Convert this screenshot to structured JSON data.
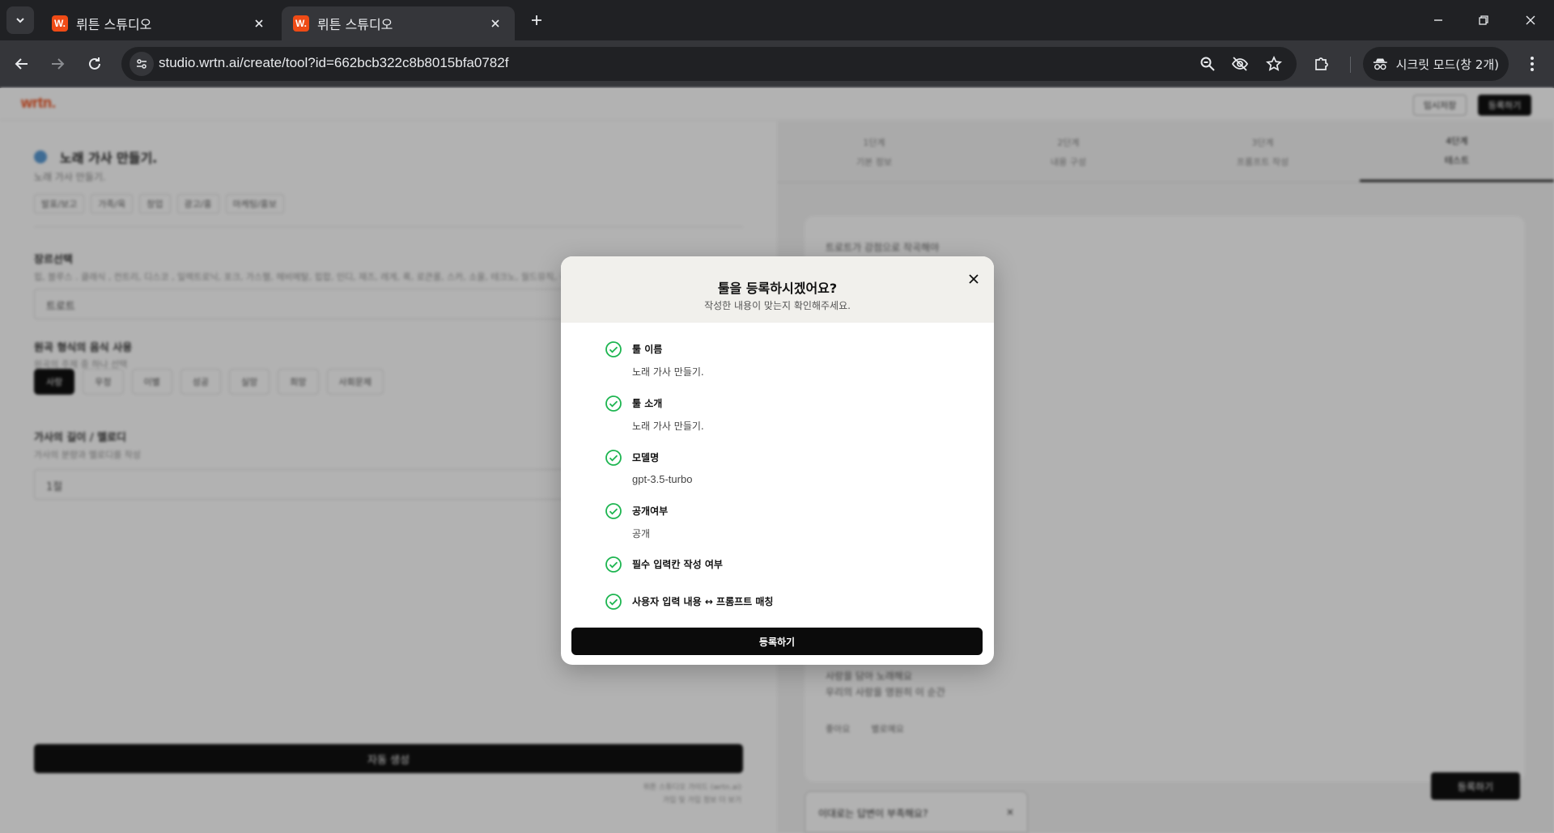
{
  "browser": {
    "tabs": [
      {
        "title": "뤼튼 스튜디오",
        "favicon": "W."
      },
      {
        "title": "뤼튼 스튜디오",
        "favicon": "W."
      }
    ],
    "url": "studio.wrtn.ai/create/tool?id=662bcb322c8b8015bfa0782f",
    "incognito_label": "시크릿 모드(창 2개)"
  },
  "page": {
    "logo": "wrtn.",
    "header_buttons": [
      "임시저장",
      "등록하기"
    ],
    "tool_title": "노래 가사 만들기.",
    "tool_subtitle": "노래 가사 만들기.",
    "tags": [
      "발표/보고",
      "가족/육",
      "창업",
      "광고/홍",
      "마케팅/홍보"
    ],
    "fields": [
      {
        "label": "장르선택",
        "hint": "힙, 블루스 . 클래식 , 컨트리, 디스코 , 일렉트로닉, 포크, 가스펠, 헤비메탈, 힙합, 인디, 재즈, 레게, 록, 로큰롤, 스카, 소울, 테크노, 월드뮤직, 국악, 트로트",
        "value": "트로트"
      },
      {
        "label": "원곡 형식의 음식 사용",
        "hint": "원곡의 주제 중 하나 선택",
        "value": ""
      },
      {
        "label": "가사의 길이 / 멜로디",
        "hint": "가사의 분량과 멜로디를 작성",
        "value": "1절"
      }
    ],
    "chips": [
      "사랑",
      "우정",
      "이별",
      "성공",
      "실망",
      "희망",
      "사회문제"
    ],
    "generate_button": "자동 생성",
    "footnotes": [
      "뤼튼 스튜디오 가이드 (wrtn.ai)",
      "가입 및 가입 정보 더 보기"
    ],
    "steps": [
      {
        "num": "1단계",
        "label": "기본 정보"
      },
      {
        "num": "2단계",
        "label": "내용 구성"
      },
      {
        "num": "3단계",
        "label": "프롬프트 작성"
      },
      {
        "num": "4단계",
        "label": "테스트"
      }
    ],
    "result_lines": [
      "트로트가 강점으로 작곡해야",
      "사랑을 담아 노래해요",
      "우리의 사랑을 영원히 이 순간"
    ],
    "card_actions": [
      "좋아요",
      "별로예요"
    ],
    "submit_button": "등록하기",
    "feedback_prompt": "이대로는 답변이 부족해요?"
  },
  "modal": {
    "title": "툴을 등록하시겠어요?",
    "subtitle": "작성한 내용이 맞는지 확인해주세요.",
    "items": [
      {
        "label": "툴 이름",
        "value": "노래 가사 만들기."
      },
      {
        "label": "툴 소개",
        "value": "노래 가사 만들기."
      },
      {
        "label": "모델명",
        "value": "gpt-3.5-turbo"
      },
      {
        "label": "공개여부",
        "value": "공개"
      },
      {
        "label": "필수 입력칸 작성 여부",
        "value": ""
      },
      {
        "label": "사용자 입력 내용 ↔ 프롬프트 매칭",
        "value": ""
      }
    ],
    "register_button": "등록하기",
    "check_color": "#1db550"
  }
}
